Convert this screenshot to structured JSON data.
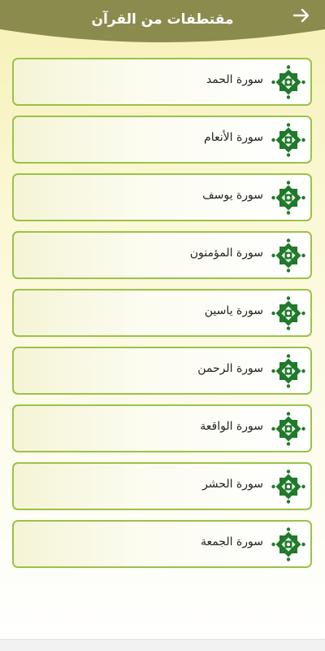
{
  "header": {
    "title": "مقتطفات من القرآن",
    "back_icon": "arrow-right-icon",
    "color": "#8b8b4e"
  },
  "surahs": [
    {
      "label": "سورة الحمد"
    },
    {
      "label": "سورة الأنعام"
    },
    {
      "label": "سورة يوسف"
    },
    {
      "label": "سورة المؤمنون"
    },
    {
      "label": "سورة ياسين"
    },
    {
      "label": "سورة الرحمن"
    },
    {
      "label": "سورة الواقعة"
    },
    {
      "label": "سورة الحشر"
    },
    {
      "label": "سورة الجمعة"
    }
  ],
  "colors": {
    "border": "#9bc247",
    "icon_green": "#1f7a2a"
  },
  "item_icon": "islamic-star-icon"
}
